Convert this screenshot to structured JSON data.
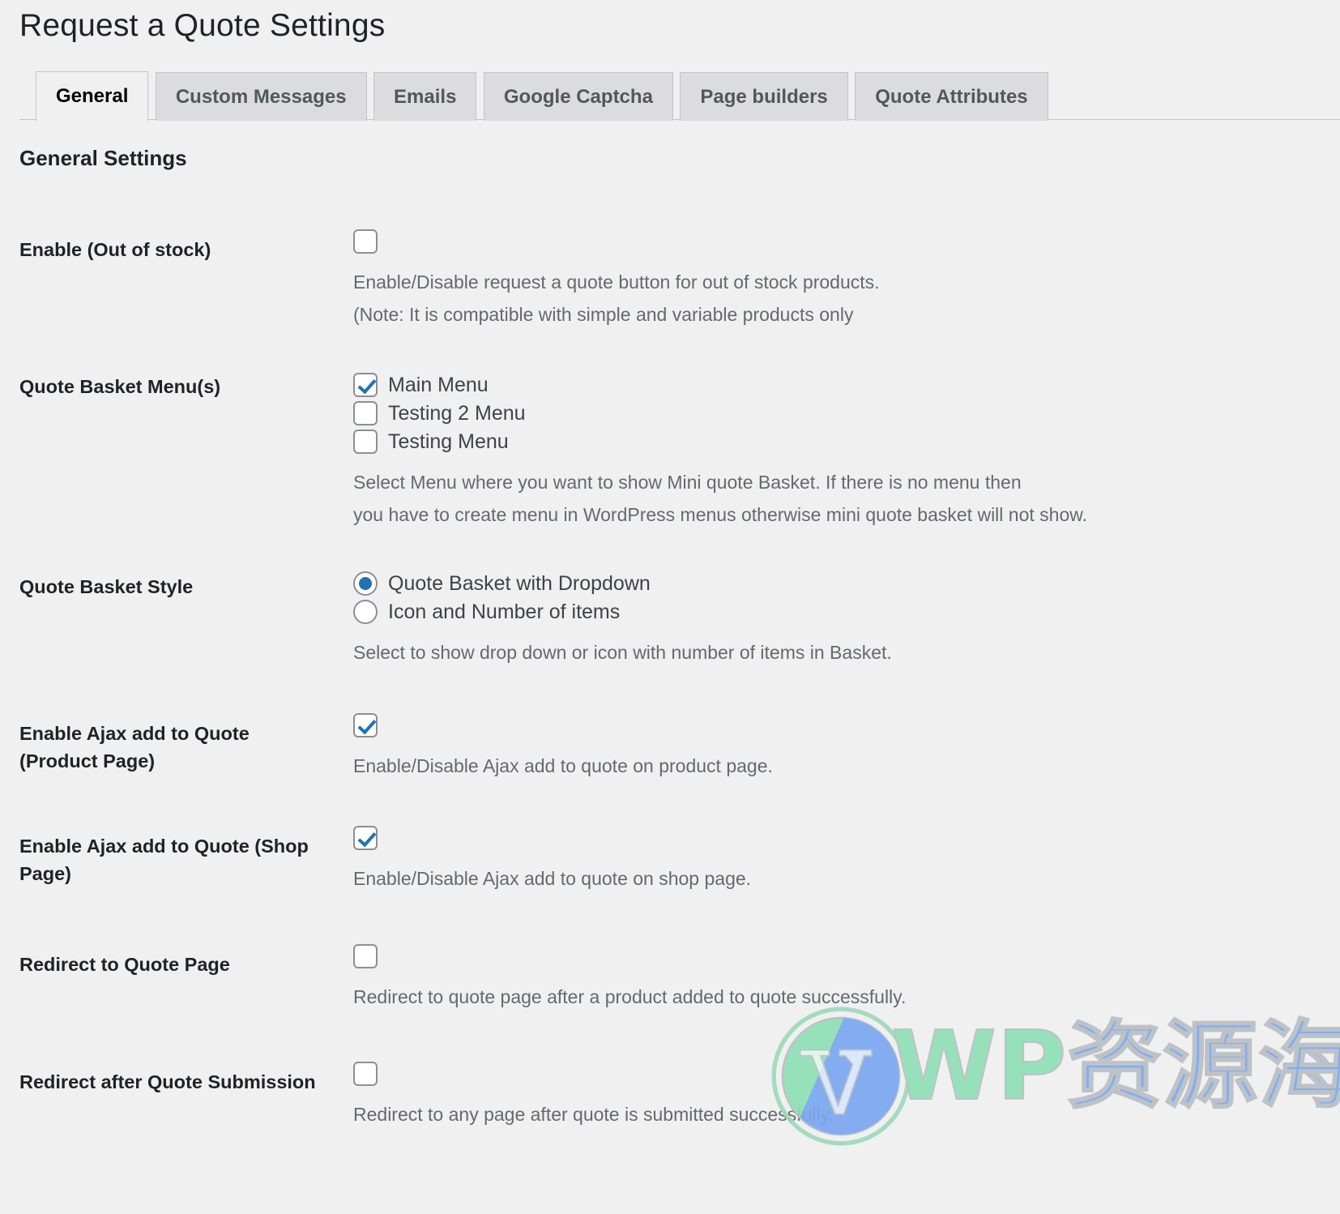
{
  "page": {
    "title": "Request a Quote Settings",
    "section_heading": "General Settings"
  },
  "tabs": [
    {
      "label": "General",
      "active": true
    },
    {
      "label": "Custom Messages",
      "active": false
    },
    {
      "label": "Emails",
      "active": false
    },
    {
      "label": "Google Captcha",
      "active": false
    },
    {
      "label": "Page builders",
      "active": false
    },
    {
      "label": "Quote Attributes",
      "active": false
    }
  ],
  "settings": {
    "out_of_stock": {
      "label": "Enable (Out of stock)",
      "checked": false,
      "desc_line1": "Enable/Disable request a quote button for out of stock products.",
      "desc_line2": "(Note: It is compatible with simple and variable products only"
    },
    "basket_menus": {
      "label": "Quote Basket Menu(s)",
      "options": [
        {
          "label": "Main Menu",
          "checked": true
        },
        {
          "label": "Testing 2 Menu",
          "checked": false
        },
        {
          "label": "Testing Menu",
          "checked": false
        }
      ],
      "desc_line1": "Select Menu where you want to show Mini quote Basket. If there is no menu then",
      "desc_line2": "you have to create menu in WordPress menus otherwise mini quote basket will not show."
    },
    "basket_style": {
      "label": "Quote Basket Style",
      "options": [
        {
          "label": "Quote Basket with Dropdown",
          "selected": true
        },
        {
          "label": "Icon and Number of items",
          "selected": false
        }
      ],
      "desc": "Select to show drop down or icon with number of items in Basket."
    },
    "ajax_product_page": {
      "label": "Enable Ajax add to Quote (Product Page)",
      "checked": true,
      "desc": "Enable/Disable Ajax add to quote on product page."
    },
    "ajax_shop_page": {
      "label": "Enable Ajax add to Quote (Shop Page)",
      "checked": true,
      "desc": "Enable/Disable Ajax add to quote on shop page."
    },
    "redirect_quote_page": {
      "label": "Redirect to Quote Page",
      "checked": false,
      "desc": "Redirect to quote page after a product added to quote successfully."
    },
    "redirect_after_submission": {
      "label": "Redirect after Quote Submission",
      "checked": false,
      "desc": "Redirect to any page after quote is submitted successfully."
    }
  },
  "watermark": {
    "logo": "wordpress-logo-icon",
    "text_en": "WP",
    "text_cn": "资源海",
    "color_en": "#8fe0b5",
    "color_cn": "#7aa8f0"
  },
  "colors": {
    "accent": "#2271b1",
    "background": "#f0f0f1",
    "tab_inactive": "#dcdcde",
    "border": "#c3c4c7",
    "text": "#1d2327",
    "muted_text": "#646970"
  }
}
